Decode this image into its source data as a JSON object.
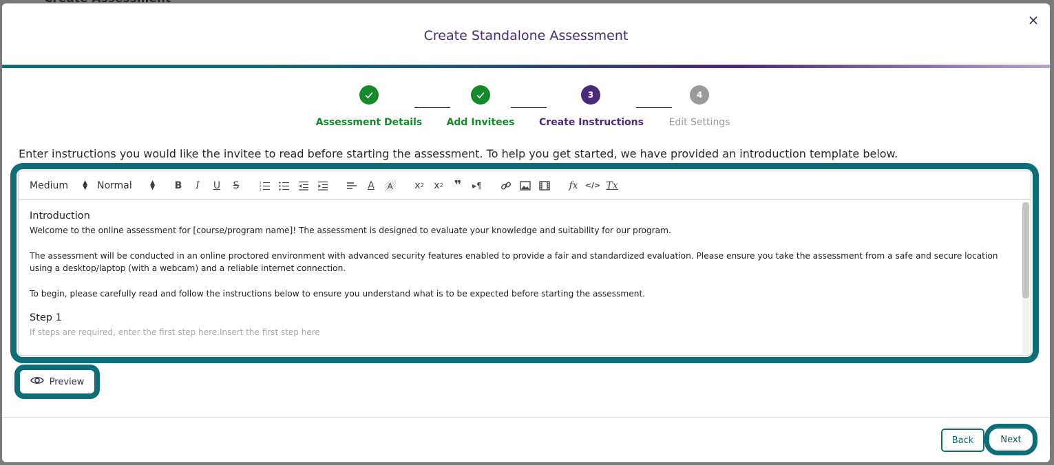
{
  "backdrop": {
    "title": "Create Assessment"
  },
  "modal": {
    "title": "Create Standalone Assessment",
    "close_icon": "×"
  },
  "colors": {
    "complete": "#148a2a",
    "active": "#4a2a7a",
    "pending": "#9a9a9a",
    "accent": "#0e6e78"
  },
  "stepper": {
    "steps": [
      {
        "label": "Assessment Details",
        "state": "complete",
        "marker": "✓"
      },
      {
        "label": "Add Invitees",
        "state": "complete",
        "marker": "✓"
      },
      {
        "label": "Create Instructions",
        "state": "active",
        "marker": "3"
      },
      {
        "label": "Edit Settings",
        "state": "pending",
        "marker": "4"
      }
    ]
  },
  "instructions_prompt": "Enter instructions you would like the invitee to read before starting the assessment. To help you get started, we have provided an introduction template below.",
  "editor": {
    "toolbar": {
      "size_select": "Medium",
      "format_select": "Normal",
      "buttons": [
        {
          "name": "bold-icon",
          "glyph": "B"
        },
        {
          "name": "italic-icon",
          "glyph": "I"
        },
        {
          "name": "underline-icon",
          "glyph": "U"
        },
        {
          "name": "strikethrough-icon",
          "glyph": "S"
        },
        {
          "name": "ordered-list-icon",
          "glyph": "≡"
        },
        {
          "name": "bullet-list-icon",
          "glyph": "☰"
        },
        {
          "name": "outdent-icon",
          "glyph": "⇤"
        },
        {
          "name": "indent-icon",
          "glyph": "⇥"
        },
        {
          "name": "align-icon",
          "glyph": "≡"
        },
        {
          "name": "font-color-icon",
          "glyph": "A"
        },
        {
          "name": "background-color-icon",
          "glyph": "A"
        },
        {
          "name": "superscript-icon",
          "glyph": "x²"
        },
        {
          "name": "subscript-icon",
          "glyph": "x₂"
        },
        {
          "name": "blockquote-icon",
          "glyph": "❞"
        },
        {
          "name": "text-direction-icon",
          "glyph": "▸¶"
        },
        {
          "name": "link-icon",
          "glyph": "🔗"
        },
        {
          "name": "image-icon",
          "glyph": "▣"
        },
        {
          "name": "video-icon",
          "glyph": "▦"
        },
        {
          "name": "formula-icon",
          "glyph": "fx"
        },
        {
          "name": "code-icon",
          "glyph": "</>"
        },
        {
          "name": "clear-format-icon",
          "glyph": "Tx"
        }
      ]
    },
    "content": {
      "heading_intro": "Introduction",
      "para1": "Welcome to the online assessment for [course/program name]! The assessment is designed to evaluate your knowledge and suitability for our program.",
      "para2": "The assessment will be conducted in an online proctored environment with advanced security features enabled to provide a fair and standardized evaluation. Please ensure you take the assessment from a safe and secure location using a desktop/laptop (with a webcam) and a reliable internet connection.",
      "para3": "To begin, please carefully read and follow the instructions below to ensure you understand what is to be expected before starting the assessment.",
      "heading_step1": "Step 1",
      "step1_placeholder": "If steps are required, enter the first step here.Insert the first step here"
    }
  },
  "preview_button": "Preview",
  "footer": {
    "back_label": "Back",
    "next_label": "Next"
  }
}
